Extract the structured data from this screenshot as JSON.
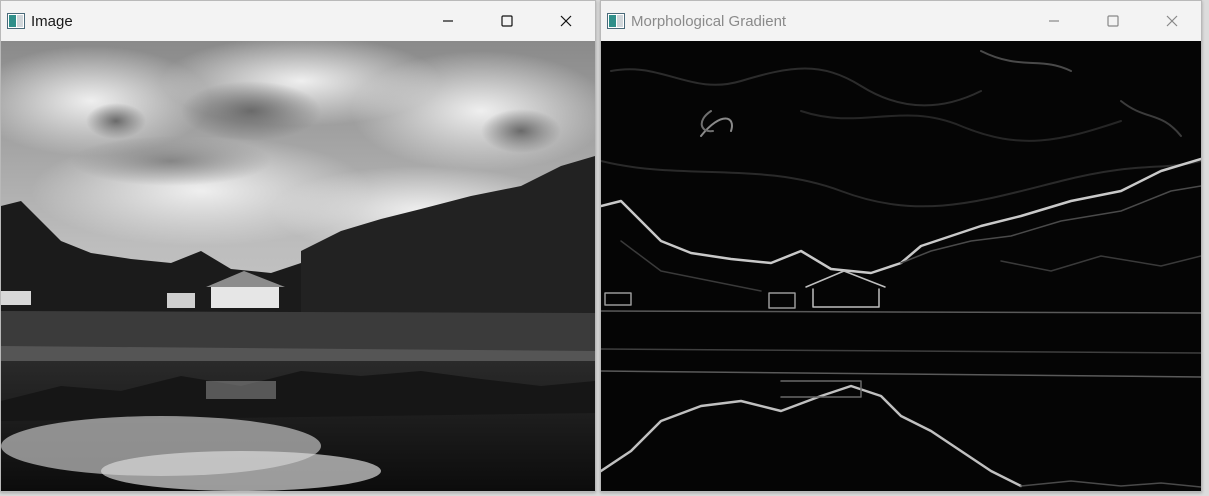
{
  "windows": {
    "left": {
      "title": "Image",
      "state": "active",
      "image_description_name": "grayscale-landscape-photo"
    },
    "right": {
      "title": "Morphological Gradient",
      "state": "inactive",
      "image_description_name": "edge-gradient-photo"
    }
  },
  "controls": [
    "minimize-icon",
    "maximize-icon",
    "close-icon"
  ],
  "colors": {
    "titlebar": "#f3f3f3",
    "title_active": "#1a1a1a",
    "title_inactive": "#8a8a8a",
    "canvas": "#000000"
  }
}
